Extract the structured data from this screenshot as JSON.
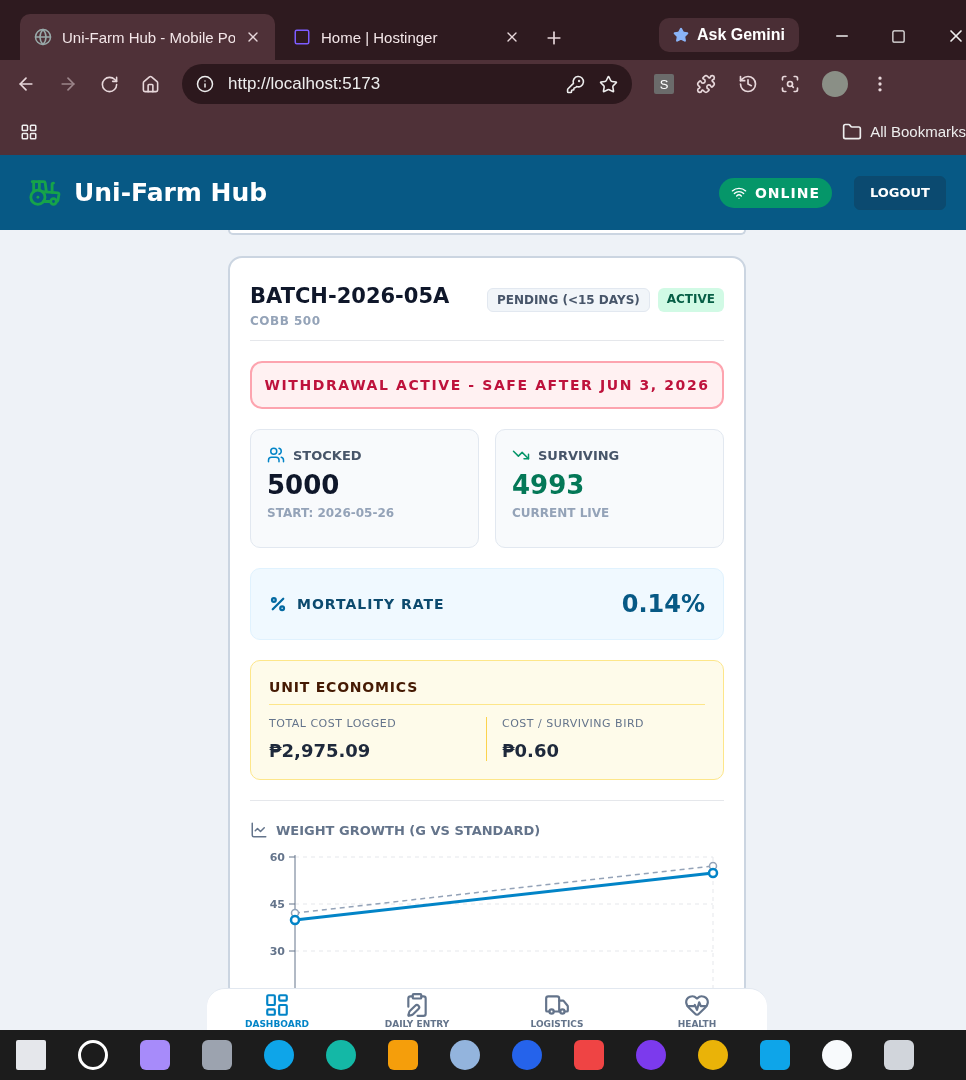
{
  "browser": {
    "tabs": [
      {
        "title": "Uni-Farm Hub - Mobile Po",
        "selected": true
      },
      {
        "title": "Home | Hostinger",
        "selected": false
      }
    ],
    "gemini_button": "Ask Gemini",
    "address": "http://localhost:5173",
    "extension_badge": "S",
    "bookmarks": "All Bookmarks"
  },
  "header": {
    "title": "Uni-Farm Hub",
    "status": "ONLINE",
    "online": true,
    "logout": "LOGOUT"
  },
  "batch": {
    "id": "BATCH-2026-05A",
    "breed": "COBB 500",
    "badges": [
      {
        "label": "PENDING (<15 DAYS)",
        "kind": "neutral"
      },
      {
        "label": "ACTIVE",
        "kind": "success"
      }
    ],
    "withdrawal_banner": "WITHDRAWAL ACTIVE - SAFE AFTER JUN 3, 2026",
    "stats": [
      {
        "kind": "stocked",
        "label": "STOCKED",
        "value": "5000",
        "note": "START: 2026-05-26"
      },
      {
        "kind": "surviving",
        "label": "SURVIVING",
        "value": "4993",
        "note": "CURRENT LIVE"
      }
    ],
    "mortality": {
      "label": "MORTALITY RATE",
      "value": "0.14%"
    },
    "economics": {
      "title": "UNIT ECONOMICS",
      "items": [
        {
          "label": "TOTAL COST LOGGED",
          "value": "₱2,975.09"
        },
        {
          "label": "COST / SURVIVING BIRD",
          "value": "₱0.60"
        }
      ]
    },
    "growth": {
      "title": "WEIGHT GROWTH (G VS STANDARD)",
      "y_tick_labels": [
        "60",
        "45",
        "30"
      ]
    }
  },
  "nav": [
    {
      "label": "DASHBOARD",
      "kind": "dashboard",
      "selected": true
    },
    {
      "label": "DAILY ENTRY",
      "kind": "entry",
      "selected": false
    },
    {
      "label": "LOGISTICS",
      "kind": "logistics",
      "selected": false
    },
    {
      "label": "HEALTH",
      "kind": "health",
      "selected": false
    }
  ]
}
